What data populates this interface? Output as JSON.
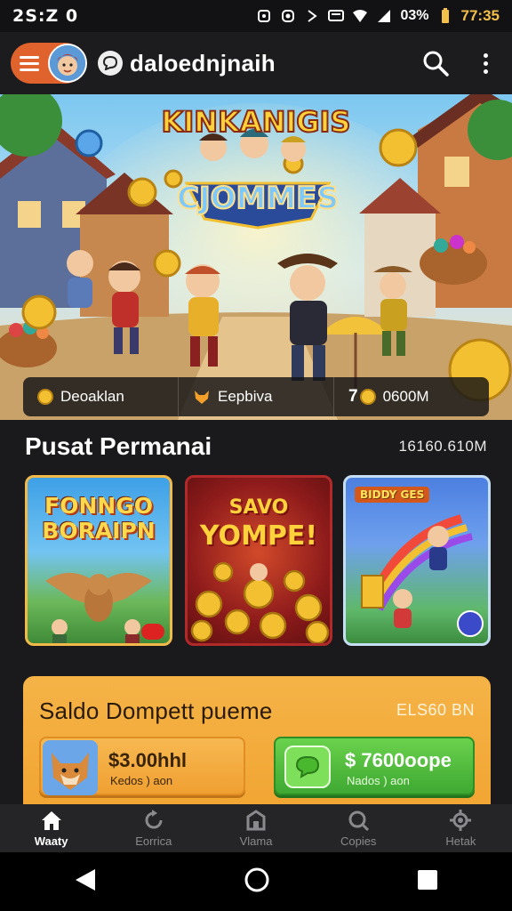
{
  "status_bar": {
    "time": "2S:Z 0",
    "battery": "03%",
    "clock": "77:35"
  },
  "app_bar": {
    "title": "daloednjnaih",
    "icons": [
      "menu-icon",
      "avatar",
      "chat-bubble-icon",
      "search-icon",
      "more-vertical-icon"
    ]
  },
  "hero": {
    "banner_line1": "KINKANIGIS",
    "banner_line2": "CJOMMES",
    "stats": [
      {
        "icon": "coin-icon",
        "label": "Deoaklan"
      },
      {
        "icon": "fox-icon",
        "label": "Eepbiva"
      },
      {
        "icon": "coin-icon",
        "prefix": "7",
        "label": "0600M"
      }
    ]
  },
  "section": {
    "title": "Pusat Permanai",
    "meta": "16160.610M"
  },
  "games": [
    {
      "title_line1": "FONNGO",
      "title_line2": "BORAIPN"
    },
    {
      "title_line1": "SAVO",
      "title_line2": "YOMPE!"
    },
    {
      "title_line1": "BIDDY GES"
    }
  ],
  "wallet": {
    "title": "Saldo Dompett pueme",
    "meta": "ELS60 BN",
    "boxes": [
      {
        "amount": "$3.00hhl",
        "sub": "Kedos ) aon"
      },
      {
        "amount": "$ 7600oope",
        "sub": "Nados ) aon"
      }
    ]
  },
  "bottom_nav": [
    {
      "label": "Waaty",
      "icon": "home-icon",
      "active": true
    },
    {
      "label": "Eorrica",
      "icon": "refresh-icon",
      "active": false
    },
    {
      "label": "Vlama",
      "icon": "store-icon",
      "active": false
    },
    {
      "label": "Copies",
      "icon": "search-icon",
      "active": false
    },
    {
      "label": "Hetak",
      "icon": "gear-icon",
      "active": false
    }
  ],
  "colors": {
    "accent_orange": "#e0622c",
    "wallet_orange": "#f5b347",
    "green": "#3ea832",
    "background": "#1a1a1c"
  }
}
